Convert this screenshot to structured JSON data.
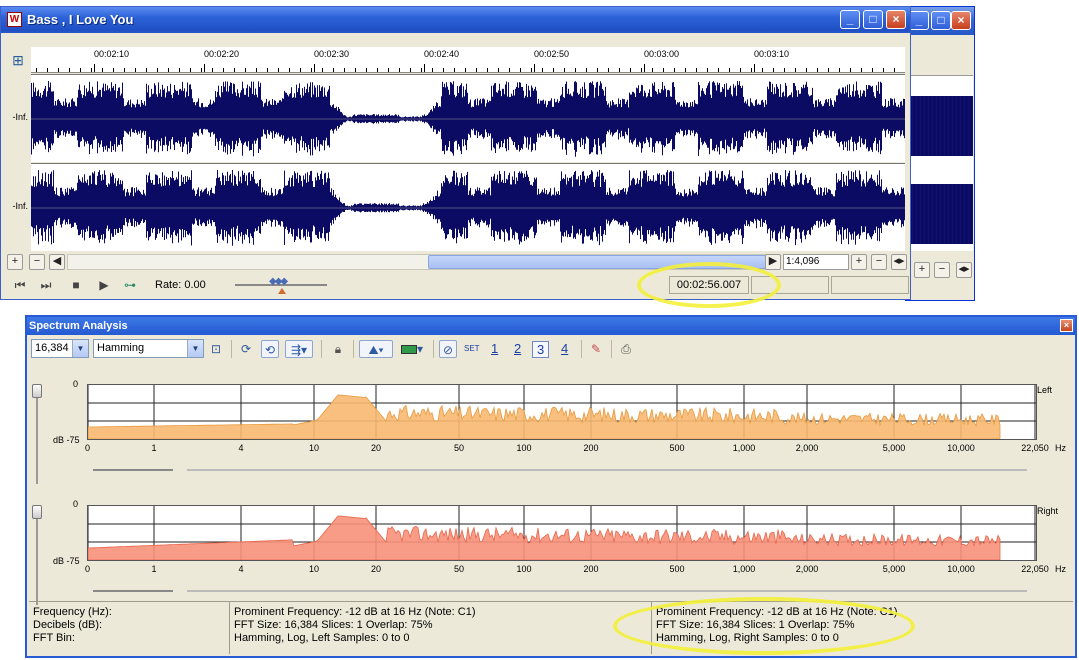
{
  "wave_window": {
    "title": "Bass , I Love You",
    "icon": "wave-app-icon",
    "caption_buttons": {
      "minimize": "_",
      "maximize": "□",
      "close": "×"
    },
    "ruler_ticks": [
      "00:02:10",
      "00:02:20",
      "00:02:30",
      "00:02:40",
      "00:02:50",
      "00:03:00",
      "00:03:10"
    ],
    "channel_labels": [
      "-Inf.",
      "-Inf."
    ],
    "zoom_plus": "+",
    "zoom_minus": "−",
    "scroll_left": "◀",
    "scroll_right": "▶",
    "zoom_ratio": "1:4,096",
    "zoom_fit": "◂▸",
    "rate_label": "Rate: 0.00",
    "position_time": "00:02:56.007",
    "waveform_color": "#0b0b63"
  },
  "spectrum": {
    "title": "Spectrum Analysis",
    "close": "×",
    "fft_size_value": "16,384",
    "window_value": "Hamming",
    "set_label": "SET",
    "presets": [
      "1",
      "2",
      "3",
      "4"
    ],
    "selected_preset": "3",
    "db_top": "0",
    "db_bottom": "dB -75",
    "x_ticks": [
      "0",
      "1",
      "4",
      "10",
      "20",
      "50",
      "100",
      "200",
      "500",
      "1,000",
      "2,000",
      "5,000",
      "10,000",
      "22,050"
    ],
    "x_unit": "Hz",
    "channels": [
      {
        "name": "Left",
        "fill": "#f7b870",
        "stroke": "#e89a40"
      },
      {
        "name": "Right",
        "fill": "#f7907a",
        "stroke": "#e8664a"
      }
    ],
    "status": {
      "labels": [
        "Frequency (Hz):",
        "Decibels (dB):",
        "FFT Bin:"
      ],
      "left": [
        "Prominent Frequency: -12 dB at 16 Hz (Note: C1)",
        "FFT Size: 16,384  Slices: 1  Overlap: 75%",
        "Hamming, Log, Left  Samples: 0 to 0"
      ],
      "right": [
        "Prominent Frequency: -12 dB at 16 Hz (Note: C1)",
        "FFT Size: 16,384  Slices: 1  Overlap: 75%",
        "Hamming, Log, Right  Samples: 0 to 0"
      ]
    }
  },
  "highlight_color": "#f4f03a"
}
